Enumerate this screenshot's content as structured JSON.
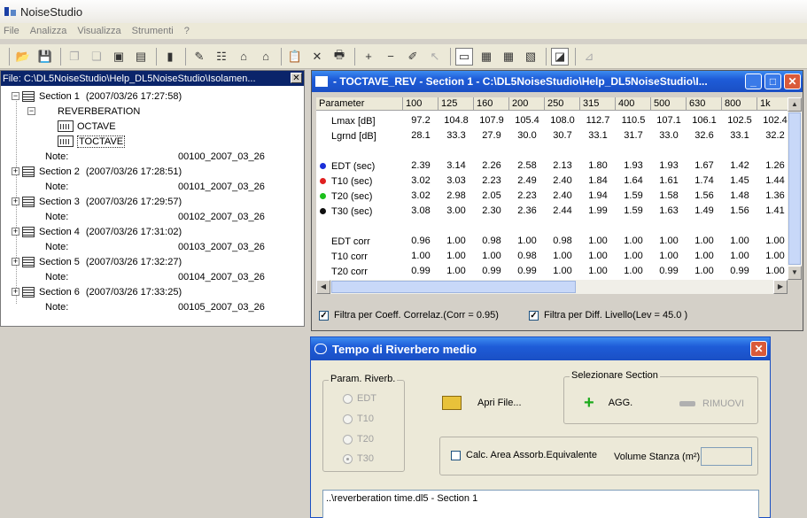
{
  "app": {
    "title": "NoiseStudio"
  },
  "menu": [
    "File",
    "Analizza",
    "Visualizza",
    "Strumenti",
    "?"
  ],
  "toolbar": [
    "open-folder-icon",
    "save-icon",
    "copy-doc-icon",
    "paste-doc-icon",
    "add-doc-icon",
    "remove-doc-icon",
    "meter-icon",
    "wizard-icon",
    "report-icon",
    "house-icon",
    "home-icon",
    "clipboard-icon",
    "excel-icon",
    "print-icon",
    "plus-icon",
    "minus-icon",
    "edit-icon",
    "pointer-icon",
    "window-icon",
    "chart-window-icon",
    "grid-window-icon",
    "yellow-window-icon",
    "graph-active-icon",
    "spectrum-icon"
  ],
  "file_panel": {
    "title": "File: C:\\DL5NoiseStudio\\Help_DL5NoiseStudio\\Isolamen...",
    "sections": [
      {
        "label": "Section 1",
        "date": "(2007/03/26 17:27:58)",
        "note_label": "Note:",
        "note": "00100_2007_03_26"
      },
      {
        "label": "Section 2",
        "date": "(2007/03/26 17:28:51)",
        "note_label": "Note:",
        "note": "00101_2007_03_26"
      },
      {
        "label": "Section 3",
        "date": "(2007/03/26 17:29:57)",
        "note_label": "Note:",
        "note": "00102_2007_03_26"
      },
      {
        "label": "Section 4",
        "date": "(2007/03/26 17:31:02)",
        "note_label": "Note:",
        "note": "00103_2007_03_26"
      },
      {
        "label": "Section 5",
        "date": "(2007/03/26 17:32:27)",
        "note_label": "Note:",
        "note": "00104_2007_03_26"
      },
      {
        "label": "Section 6",
        "date": "(2007/03/26 17:33:25)",
        "note_label": "Note:",
        "note": "00105_2007_03_26"
      }
    ],
    "reverberation": "REVERBERATION",
    "octave": "OCTAVE",
    "toctave": "TOCTAVE"
  },
  "toctave_window": {
    "title": "- TOCTAVE_REV - Section 1 -  C:\\DL5NoiseStudio\\Help_DL5NoiseStudio\\I...",
    "param_header": "Parameter",
    "freqs": [
      "100",
      "125",
      "160",
      "200",
      "250",
      "315",
      "400",
      "500",
      "630",
      "800",
      "1k"
    ],
    "rows": [
      {
        "label": "Lmax [dB]",
        "dot": "",
        "values": [
          "97.2",
          "104.8",
          "107.9",
          "105.4",
          "108.0",
          "112.7",
          "110.5",
          "107.1",
          "106.1",
          "102.5",
          "102.4"
        ]
      },
      {
        "label": "Lgrnd [dB]",
        "dot": "",
        "values": [
          "28.1",
          "33.3",
          "27.9",
          "30.0",
          "30.7",
          "33.1",
          "31.7",
          "33.0",
          "32.6",
          "33.1",
          "32.2"
        ]
      },
      {
        "label": "EDT (sec)",
        "dot": "#1a2fd8",
        "values": [
          "2.39",
          "3.14",
          "2.26",
          "2.58",
          "2.13",
          "1.80",
          "1.93",
          "1.93",
          "1.67",
          "1.42",
          "1.26"
        ]
      },
      {
        "label": "T10 (sec)",
        "dot": "#e02020",
        "values": [
          "3.02",
          "3.03",
          "2.23",
          "2.49",
          "2.40",
          "1.84",
          "1.64",
          "1.61",
          "1.74",
          "1.45",
          "1.44"
        ]
      },
      {
        "label": "T20 (sec)",
        "dot": "#1cc01c",
        "values": [
          "3.02",
          "2.98",
          "2.05",
          "2.23",
          "2.40",
          "1.94",
          "1.59",
          "1.58",
          "1.56",
          "1.48",
          "1.36"
        ]
      },
      {
        "label": "T30 (sec)",
        "dot": "#101010",
        "values": [
          "3.08",
          "3.00",
          "2.30",
          "2.36",
          "2.44",
          "1.99",
          "1.59",
          "1.63",
          "1.49",
          "1.56",
          "1.41"
        ]
      },
      {
        "label": "EDT corr",
        "dot": "",
        "values": [
          "0.96",
          "1.00",
          "0.98",
          "1.00",
          "0.98",
          "1.00",
          "1.00",
          "1.00",
          "1.00",
          "1.00",
          "1.00"
        ]
      },
      {
        "label": "T10 corr",
        "dot": "",
        "values": [
          "1.00",
          "1.00",
          "1.00",
          "0.98",
          "1.00",
          "1.00",
          "1.00",
          "1.00",
          "1.00",
          "1.00",
          "1.00"
        ]
      },
      {
        "label": "T20 corr",
        "dot": "",
        "values": [
          "0.99",
          "1.00",
          "0.99",
          "0.99",
          "1.00",
          "1.00",
          "1.00",
          "0.99",
          "1.00",
          "0.99",
          "1.00"
        ]
      }
    ],
    "filter_corr": "Filtra per Coeff. Correlaz.(Corr = 0.95)",
    "filter_diff": "Filtra per Diff. Livello(Lev = 45.0 )"
  },
  "dialog": {
    "title": "Tempo di Riverbero medio",
    "param_group": "Param. Riverb.",
    "radios": [
      "EDT",
      "T10",
      "T20",
      "T30"
    ],
    "selected_radio": "T30",
    "open_file": "Apri File...",
    "section_group": "Selezionare Section",
    "add": "AGG.",
    "remove": "RIMUOVI",
    "calc_area": "Calc. Area Assorb.Equivalente",
    "volume_label": "Volume Stanza (m²)",
    "volume_value": "",
    "list_items": [
      "..\\reverberation time.dl5 - Section 1"
    ]
  }
}
